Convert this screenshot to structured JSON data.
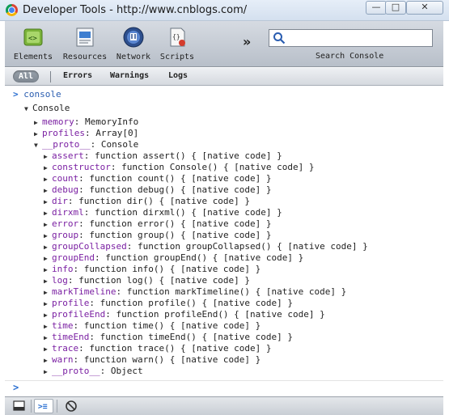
{
  "window": {
    "title": "Developer Tools - http://www.cnblogs.com/",
    "minimize_glyph": "—",
    "maximize_glyph": "□",
    "close_glyph": "✕"
  },
  "toolbar": {
    "tools": [
      {
        "label": "Elements",
        "icon": "elements-icon"
      },
      {
        "label": "Resources",
        "icon": "resources-icon"
      },
      {
        "label": "Network",
        "icon": "network-icon"
      },
      {
        "label": "Scripts",
        "icon": "scripts-icon"
      }
    ],
    "more_glyph": "»",
    "search": {
      "value": "",
      "placeholder": "",
      "label": "Search Console"
    }
  },
  "filters": {
    "all": "All",
    "errors": "Errors",
    "warnings": "Warnings",
    "logs": "Logs",
    "active": "All"
  },
  "console": {
    "prompt": ">",
    "command": "console",
    "object_name": "Console",
    "properties": [
      {
        "key": "memory",
        "value": "MemoryInfo",
        "level": 1,
        "expanded": false
      },
      {
        "key": "profiles",
        "value": "Array[0]",
        "level": 1,
        "expanded": false
      },
      {
        "key": "__proto__",
        "value": "Console",
        "level": 1,
        "expanded": true
      },
      {
        "key": "assert",
        "value": "function assert() { [native code] }",
        "level": 2,
        "expanded": false
      },
      {
        "key": "constructor",
        "value": "function Console() { [native code] }",
        "level": 2,
        "expanded": false
      },
      {
        "key": "count",
        "value": "function count() { [native code] }",
        "level": 2,
        "expanded": false
      },
      {
        "key": "debug",
        "value": "function debug() { [native code] }",
        "level": 2,
        "expanded": false
      },
      {
        "key": "dir",
        "value": "function dir() { [native code] }",
        "level": 2,
        "expanded": false
      },
      {
        "key": "dirxml",
        "value": "function dirxml() { [native code] }",
        "level": 2,
        "expanded": false
      },
      {
        "key": "error",
        "value": "function error() { [native code] }",
        "level": 2,
        "expanded": false
      },
      {
        "key": "group",
        "value": "function group() { [native code] }",
        "level": 2,
        "expanded": false
      },
      {
        "key": "groupCollapsed",
        "value": "function groupCollapsed() { [native code] }",
        "level": 2,
        "expanded": false
      },
      {
        "key": "groupEnd",
        "value": "function groupEnd() { [native code] }",
        "level": 2,
        "expanded": false
      },
      {
        "key": "info",
        "value": "function info() { [native code] }",
        "level": 2,
        "expanded": false
      },
      {
        "key": "log",
        "value": "function log() { [native code] }",
        "level": 2,
        "expanded": false
      },
      {
        "key": "markTimeline",
        "value": "function markTimeline() { [native code] }",
        "level": 2,
        "expanded": false
      },
      {
        "key": "profile",
        "value": "function profile() { [native code] }",
        "level": 2,
        "expanded": false
      },
      {
        "key": "profileEnd",
        "value": "function profileEnd() { [native code] }",
        "level": 2,
        "expanded": false
      },
      {
        "key": "time",
        "value": "function time() { [native code] }",
        "level": 2,
        "expanded": false
      },
      {
        "key": "timeEnd",
        "value": "function timeEnd() { [native code] }",
        "level": 2,
        "expanded": false
      },
      {
        "key": "trace",
        "value": "function trace() { [native code] }",
        "level": 2,
        "expanded": false
      },
      {
        "key": "warn",
        "value": "function warn() { [native code] }",
        "level": 2,
        "expanded": false
      },
      {
        "key": "__proto__",
        "value": "Object",
        "level": 2,
        "expanded": false
      }
    ],
    "input_prompt": ">"
  },
  "statusbar": {
    "buttons": [
      {
        "name": "dock-to-main-window-icon"
      },
      {
        "name": "console-toggle-icon"
      },
      {
        "name": "clear-console-icon"
      }
    ]
  },
  "colors": {
    "property_key": "#7a1fa2",
    "prompt": "#2a6fd1",
    "toolbar_top": "#d6dbe2",
    "toolbar_bottom": "#b8bfc9"
  }
}
